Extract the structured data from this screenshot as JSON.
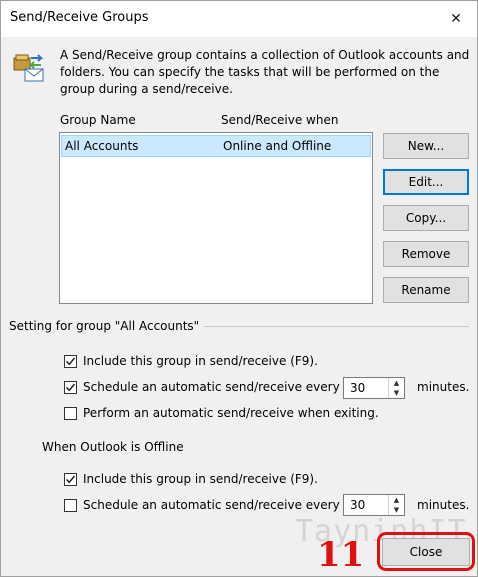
{
  "window": {
    "title": "Send/Receive Groups",
    "close_glyph": "✕"
  },
  "intro": {
    "icon": "send-receive-icon",
    "text": "A Send/Receive group contains a collection of Outlook accounts and folders. You can specify the tasks that will be performed on the group during a send/receive."
  },
  "groups_list": {
    "columns": [
      "Group Name",
      "Send/Receive when"
    ],
    "rows": [
      {
        "name": "All Accounts",
        "when": "Online and Offline",
        "selected": true
      }
    ]
  },
  "buttons": {
    "new": "New...",
    "edit": "Edit...",
    "copy": "Copy...",
    "remove": "Remove",
    "rename": "Rename",
    "close": "Close"
  },
  "online_section": {
    "label": "Setting for group \"All Accounts\"",
    "include": {
      "label": "Include this group in send/receive (F9).",
      "checked": true
    },
    "schedule": {
      "label": "Schedule an automatic send/receive every",
      "checked": true,
      "value": "30",
      "unit": "minutes."
    },
    "exit": {
      "label": "Perform an automatic send/receive when exiting.",
      "checked": false
    }
  },
  "offline_section": {
    "label": "When Outlook is Offline",
    "include": {
      "label": "Include this group in send/receive (F9).",
      "checked": true
    },
    "schedule": {
      "label": "Schedule an automatic send/receive every",
      "checked": false,
      "value": "30",
      "unit": "minutes."
    }
  },
  "overlay": {
    "watermark": "TayninhIT",
    "step_number": "11",
    "annotation_color": "#e01010"
  },
  "colors": {
    "selection": "#cce8ff",
    "default_button_border": "#0078d7"
  }
}
